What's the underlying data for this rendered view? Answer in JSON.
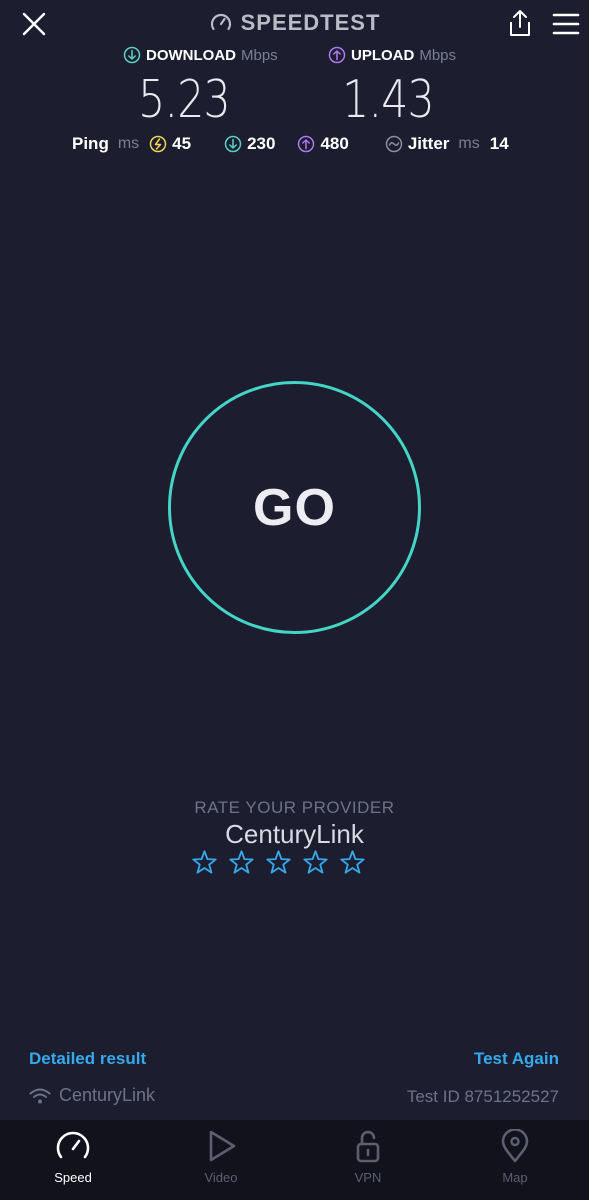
{
  "header": {
    "brand": "SPEEDTEST"
  },
  "metrics": {
    "download_label": "DOWNLOAD",
    "download_unit": "Mbps",
    "download_value": "5.23",
    "upload_label": "UPLOAD",
    "upload_unit": "Mbps",
    "upload_value": "1.43"
  },
  "stats": {
    "ping_label": "Ping",
    "ping_unit": "ms",
    "ping_value": "45",
    "download_latency": "230",
    "upload_latency": "480",
    "jitter_label": "Jitter",
    "jitter_unit": "ms",
    "jitter_value": "14"
  },
  "go_label": "GO",
  "rating": {
    "label": "RATE YOUR PROVIDER",
    "provider": "CenturyLink",
    "stars_filled": 0,
    "stars_total": 5
  },
  "footer": {
    "detailed_link": "Detailed result",
    "test_again_link": "Test Again",
    "isp_name": "CenturyLink",
    "test_id": "Test ID 8751252527"
  },
  "nav": {
    "items": [
      {
        "label": "Speed",
        "icon": "speedometer-icon"
      },
      {
        "label": "Video",
        "icon": "play-icon"
      },
      {
        "label": "VPN",
        "icon": "unlock-icon"
      },
      {
        "label": "Map",
        "icon": "map-pin-icon"
      }
    ],
    "active": "Speed"
  },
  "colors": {
    "background": "#1c1e2f",
    "accent_teal": "#44d4c8",
    "download": "#5ad0c5",
    "upload": "#b078f0",
    "ping": "#f2d35a",
    "link": "#35a9ec",
    "nav_background": "#11121c"
  }
}
